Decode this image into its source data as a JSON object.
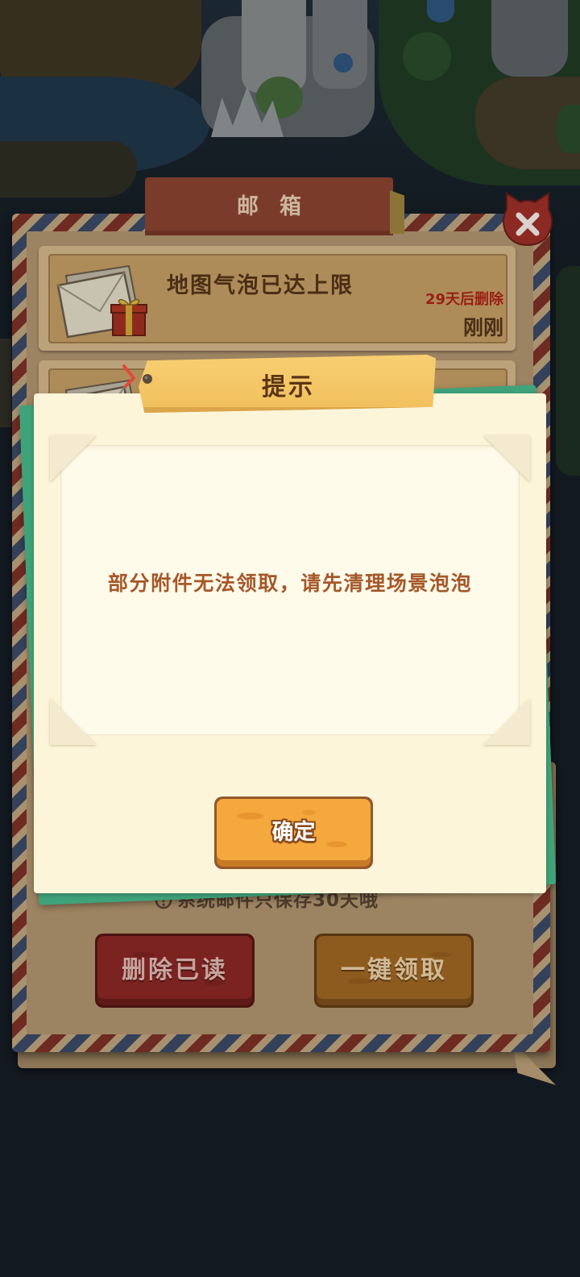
{
  "colors": {
    "background": "#121920",
    "dialog_paper": "#fcf5d9",
    "dialog_green": "#3fa37a",
    "tag_yellow": "#f1bf5c",
    "message_text": "#a5582a",
    "confirm_orange": "#f4a83d",
    "mail_expire_red": "#9b1f14"
  },
  "mailbox": {
    "title": "邮箱",
    "close_icon": "close-icon",
    "mails": [
      {
        "icon": "envelope-gift-icon",
        "title": "地图气泡已达上限",
        "expire": "29天后删除",
        "time": "刚刚"
      },
      {
        "icon": "envelope-icon"
      }
    ],
    "notice_icon": "info-icon",
    "notice": "系统邮件只保存30天哦",
    "delete_read_label": "删除已读",
    "claim_all_label": "一键领取"
  },
  "dialog": {
    "title": "提示",
    "message": "部分附件无法领取，请先清理场景泡泡",
    "confirm_label": "确定"
  }
}
